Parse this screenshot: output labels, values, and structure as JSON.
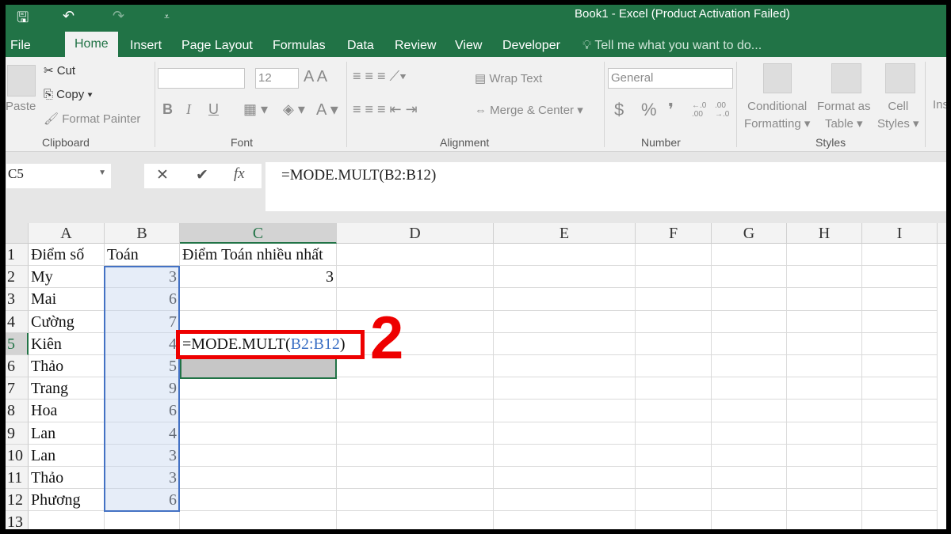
{
  "window": {
    "title": "Book1 - Excel (Product Activation Failed)"
  },
  "qat": {
    "save": "🖫",
    "undo": "↶",
    "redo": "↷",
    "more": "⩡"
  },
  "tabs": [
    "File",
    "Home",
    "Insert",
    "Page Layout",
    "Formulas",
    "Data",
    "Review",
    "View",
    "Developer"
  ],
  "active_tab": "Home",
  "tell_me": "Tell me what you want to do...",
  "ribbon": {
    "clipboard": {
      "paste": "Paste",
      "cut": "Cut",
      "copy": "Copy",
      "format_painter": "Format Painter",
      "label": "Clipboard"
    },
    "font": {
      "name": "",
      "size": "12",
      "bold": "B",
      "italic": "I",
      "underline": "U",
      "label": "Font"
    },
    "alignment": {
      "wrap": "Wrap Text",
      "merge": "Merge & Center",
      "label": "Alignment"
    },
    "number": {
      "format": "General",
      "currency": "$",
      "percent": "%",
      "comma": "❜",
      "inc": "←.0 .00",
      "dec": ".00 →.0",
      "label": "Number"
    },
    "styles": {
      "conditional": "Conditional",
      "conditional2": "Formatting",
      "format_table": "Format as",
      "format_table2": "Table",
      "cell_styles": "Cell",
      "cell_styles2": "Styles",
      "label": "Styles"
    },
    "cells": {
      "insert": "Ins"
    }
  },
  "formula_bar": {
    "name_box": "C5",
    "cancel": "✕",
    "enter": "✔",
    "fx": "fx",
    "formula": "=MODE.MULT(B2:B12)"
  },
  "sheet": {
    "columns": [
      "A",
      "B",
      "C",
      "D",
      "E",
      "F",
      "G",
      "H",
      "I"
    ],
    "selected_column": "C",
    "rows": [
      [
        "Điểm số",
        "Toán",
        "Điểm Toán nhiều nhất"
      ],
      [
        "My",
        "3",
        "3"
      ],
      [
        "Mai",
        "6",
        ""
      ],
      [
        "Cường",
        "7",
        ""
      ],
      [
        "Kiên",
        "4",
        ""
      ],
      [
        "Thảo",
        "5",
        ""
      ],
      [
        "Trang",
        "9",
        ""
      ],
      [
        "Hoa",
        "6",
        ""
      ],
      [
        "Lan",
        "4",
        ""
      ],
      [
        "Lan",
        "3",
        ""
      ],
      [
        "Thảo",
        "3",
        ""
      ],
      [
        "Phương",
        "6",
        ""
      ],
      [
        "",
        "",
        ""
      ]
    ],
    "editing": {
      "cell": "C5",
      "prefix": "=MODE.MULT(",
      "range": "B2:B12",
      "suffix": ")"
    }
  },
  "annotation": {
    "step": "2",
    "color": "#ee0000"
  },
  "colors": {
    "accent": "#217346",
    "range": "#4472c4"
  }
}
